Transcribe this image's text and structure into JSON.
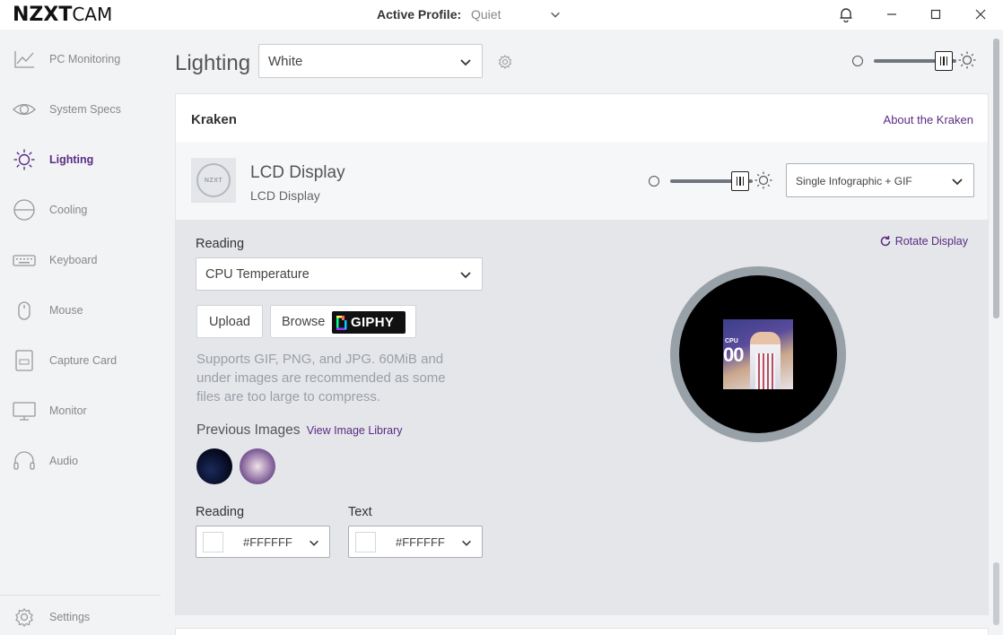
{
  "app": {
    "logo_bold": "NZXT",
    "logo_light": "CAM"
  },
  "titlebar": {
    "profile_label": "Active Profile:",
    "profile_value": "Quiet"
  },
  "sidebar": {
    "items": [
      {
        "label": "PC Monitoring",
        "icon": "chart-line-icon"
      },
      {
        "label": "System Specs",
        "icon": "eye-icon"
      },
      {
        "label": "Lighting",
        "icon": "sun-icon",
        "active": true
      },
      {
        "label": "Cooling",
        "icon": "fan-icon"
      },
      {
        "label": "Keyboard",
        "icon": "keyboard-icon"
      },
      {
        "label": "Mouse",
        "icon": "mouse-icon"
      },
      {
        "label": "Capture Card",
        "icon": "capture-card-icon"
      },
      {
        "label": "Monitor",
        "icon": "monitor-icon"
      },
      {
        "label": "Audio",
        "icon": "headset-icon"
      }
    ],
    "settings_label": "Settings"
  },
  "main": {
    "title": "Lighting",
    "preset": "White",
    "global_brightness": 0.85,
    "card": {
      "title": "Kraken",
      "about_link": "About the Kraken",
      "lcd": {
        "name": "LCD Display",
        "subtitle": "LCD Display",
        "thumb_text": "NZXT",
        "brightness": 0.85,
        "mode": "Single Infographic + GIF"
      },
      "config": {
        "reading_label": "Reading",
        "reading_value": "CPU Temperature",
        "upload_label": "Upload",
        "browse_label": "Browse",
        "giphy_label": "GIPHY",
        "supports_text": "Supports GIF, PNG, and JPG. 60MiB and under images are recommended as some files are too large to compress.",
        "previous_label": "Previous Images",
        "library_link": "View Image Library",
        "reading_color_label": "Reading",
        "reading_color": "#FFFFFF",
        "text_color_label": "Text",
        "text_color": "#FFFFFF",
        "rotate_label": "Rotate Display",
        "preview_cpu_label": "CPU",
        "preview_value": "00"
      }
    }
  },
  "colors": {
    "accent": "#5b2c83",
    "sidebar_bg": "#f2f3f5",
    "config_bg": "#e4e6e9",
    "lcd_ring": "#98a0a8"
  }
}
